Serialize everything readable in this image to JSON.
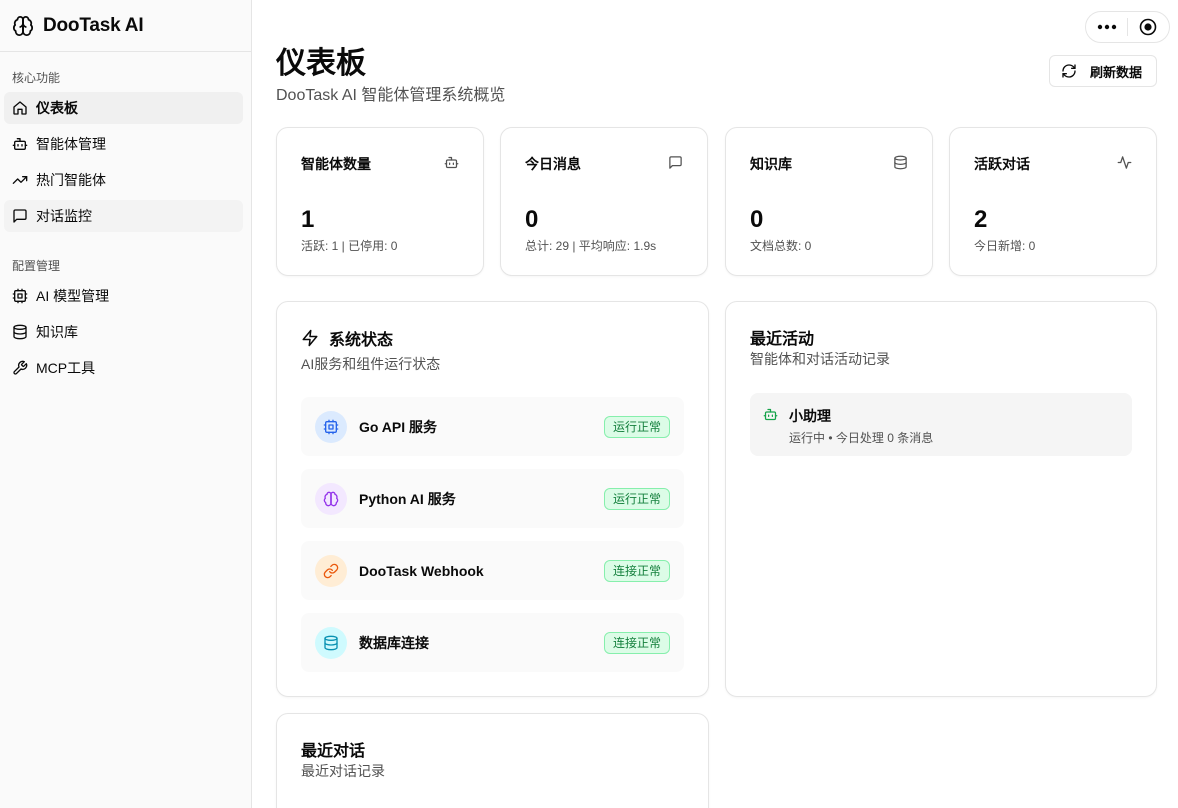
{
  "app": {
    "title": "DooTask AI"
  },
  "sidebar": {
    "groups": [
      {
        "label": "核心功能",
        "items": [
          {
            "label": "仪表板",
            "icon": "home-icon"
          },
          {
            "label": "智能体管理",
            "icon": "bot-icon"
          },
          {
            "label": "热门智能体",
            "icon": "trending-up-icon"
          },
          {
            "label": "对话监控",
            "icon": "message-square-icon"
          }
        ]
      },
      {
        "label": "配置管理",
        "items": [
          {
            "label": "AI 模型管理",
            "icon": "cpu-icon"
          },
          {
            "label": "知识库",
            "icon": "database-icon"
          },
          {
            "label": "MCP工具",
            "icon": "wrench-icon"
          }
        ]
      }
    ]
  },
  "header": {
    "title": "仪表板",
    "subtitle": "DooTask AI 智能体管理系统概览",
    "refresh_label": "刷新数据"
  },
  "stats": [
    {
      "title": "智能体数量",
      "value": "1",
      "sub": "活跃: 1 | 已停用: 0",
      "icon": "bot-icon"
    },
    {
      "title": "今日消息",
      "value": "0",
      "sub": "总计: 29 | 平均响应: 1.9s",
      "icon": "message-square-icon"
    },
    {
      "title": "知识库",
      "value": "0",
      "sub": "文档总数: 0",
      "icon": "database-icon"
    },
    {
      "title": "活跃对话",
      "value": "2",
      "sub": "今日新增: 0",
      "icon": "activity-icon"
    }
  ],
  "system_status": {
    "title": "系统状态",
    "subtitle": "AI服务和组件运行状态",
    "items": [
      {
        "name": "Go API 服务",
        "status": "运行正常",
        "icon": "cpu-icon",
        "color": "#2563eb",
        "bg": "#dbeafe"
      },
      {
        "name": "Python AI 服务",
        "status": "运行正常",
        "icon": "brain-icon",
        "color": "#9333ea",
        "bg": "#f3e8ff"
      },
      {
        "name": "DooTask Webhook",
        "status": "连接正常",
        "icon": "link-icon",
        "color": "#ea580c",
        "bg": "#ffedd5"
      },
      {
        "name": "数据库连接",
        "status": "连接正常",
        "icon": "database-icon",
        "color": "#0891b2",
        "bg": "#cffafe"
      }
    ]
  },
  "recent_activity": {
    "title": "最近活动",
    "subtitle": "智能体和对话活动记录",
    "items": [
      {
        "name": "小助理",
        "desc": "运行中 • 今日处理 0 条消息",
        "icon": "bot-icon",
        "color": "#16a34a"
      }
    ]
  },
  "recent_conversations": {
    "title": "最近对话",
    "subtitle": "最近对话记录"
  },
  "colors": {
    "accent_green": "#16a34a",
    "badge_bg": "#dcfce7",
    "badge_border": "#86efac"
  }
}
